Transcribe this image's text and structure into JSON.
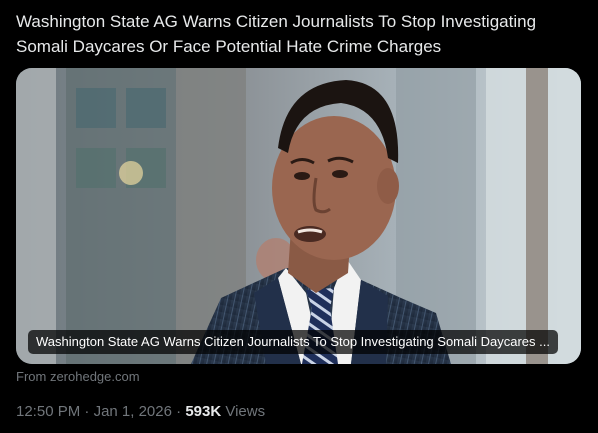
{
  "tweet": {
    "text": "Washington State AG Warns Citizen Journalists To Stop Investigating Somali Daycares Or Face Potential Hate Crime Charges"
  },
  "card": {
    "image_subject": "photo of a man in a pinstripe suit and striped tie speaking outdoors",
    "caption": "Washington State AG Warns Citizen Journalists To Stop Investigating Somali Daycares ...",
    "source": "From zerohedge.com"
  },
  "meta": {
    "time": "12:50 PM",
    "separator": "·",
    "date": "Jan 1, 2026",
    "views_count": "593K",
    "views_label": "Views"
  },
  "colors": {
    "background": "#000000",
    "primary_text": "#e7e9ea",
    "secondary_text": "#71767b"
  }
}
